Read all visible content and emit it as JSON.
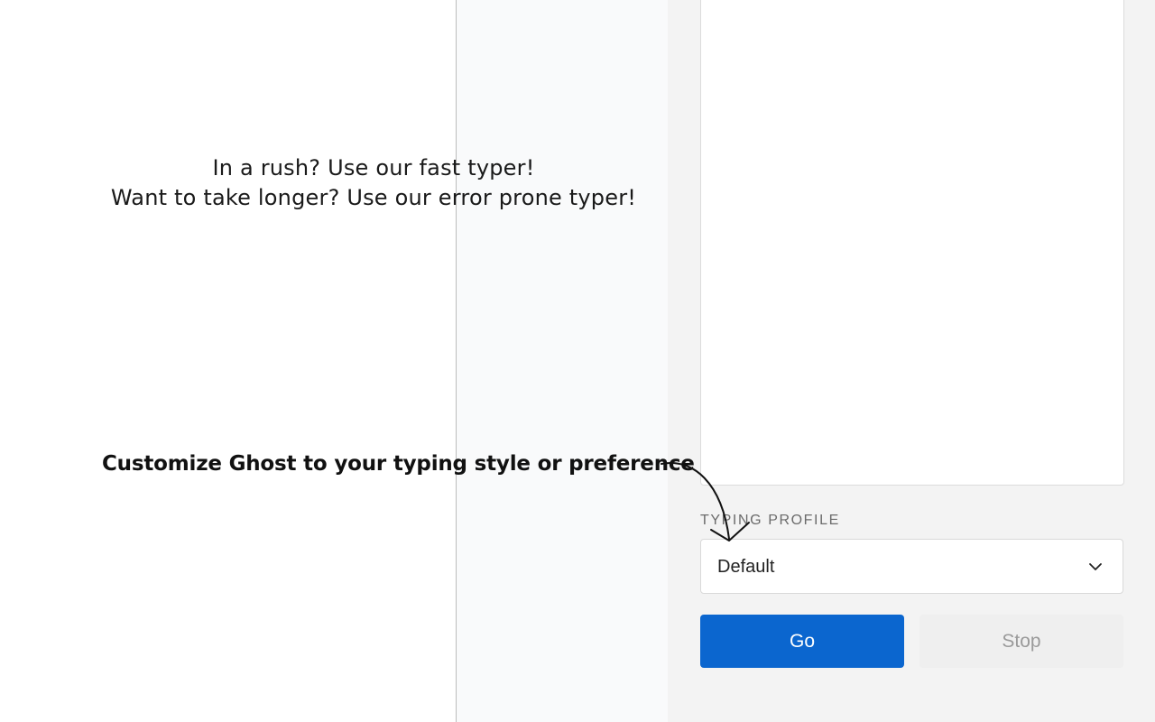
{
  "promo": {
    "line1": "In a rush? Use our fast typer!",
    "line2": "Want to take longer? Use our error prone typer!"
  },
  "callout": {
    "text": "Customize Ghost to your typing style or preference"
  },
  "panel": {
    "profile_label": "TYPING PROFILE",
    "profile_value": "Default",
    "go_label": "Go",
    "stop_label": "Stop"
  },
  "colors": {
    "accent": "#0b66cf",
    "panel_bg": "#f3f3f3"
  },
  "icons": {
    "select_arrow": "chevron-down-icon",
    "callout_arrow": "hand-drawn-arrow-icon"
  }
}
